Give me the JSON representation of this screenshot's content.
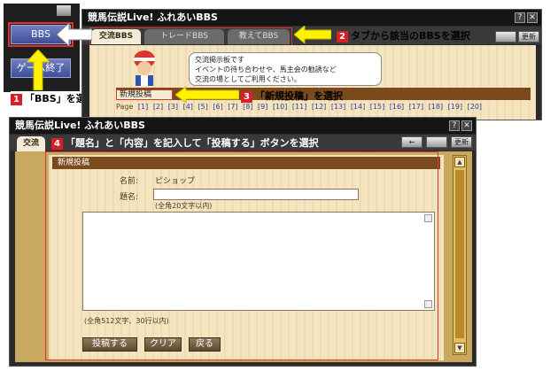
{
  "side": {
    "bbs_label": "BBS",
    "quit_label": "ゲーム終了"
  },
  "back_window": {
    "title": "競馬伝説Live! ふれあいBBS",
    "help": "?",
    "close": "✕",
    "tabs": [
      {
        "label": "交流BBS",
        "active": true
      },
      {
        "label": "トレードBBS",
        "active": false
      },
      {
        "label": "教えてBBS",
        "active": false
      }
    ],
    "update": "更新",
    "speech": [
      "交流掲示板です",
      "イベントの待ち合わせや、馬主会の勧誘など",
      "交流の場としてご利用ください。"
    ],
    "new_post_label": "新規投稿",
    "page_label": "Page",
    "pages": [
      "[1]",
      "[2]",
      "[3]",
      "[4]",
      "[5]",
      "[6]",
      "[7]",
      "[8]",
      "[9]",
      "[10]",
      "[11]",
      "[12]",
      "[13]",
      "[14]",
      "[15]",
      "[16]",
      "[17]",
      "[18]",
      "[19]",
      "[20]"
    ]
  },
  "front_window": {
    "title": "競馬伝説Live! ふれあいBBS",
    "help": "?",
    "close": "✕",
    "tab_partial": "交流",
    "update": "更新",
    "form_header": "新規投稿",
    "name_label": "名前:",
    "name_value": "ピショップ",
    "subject_label": "題名:",
    "subject_hint": "(全角20文字以内)",
    "content_hint": "(全角512文字、30行以内)",
    "buttons": {
      "post": "投稿する",
      "clear": "クリア",
      "back": "戻る"
    }
  },
  "callouts": {
    "c1": {
      "num": "1",
      "text": "「BBS」を選択"
    },
    "c2": {
      "num": "2",
      "text": "タブから該当のBBSを選択"
    },
    "c3": {
      "num": "3",
      "text": "「新規投稿」を選択"
    },
    "c4": {
      "num": "4",
      "text": "「題名」と「内容」を記入して「投稿する」ボタンを選択"
    }
  },
  "colors": {
    "callout_red": "#e0322f",
    "arrow_yellow": "#fff200",
    "wood": "#f4e5c0"
  }
}
